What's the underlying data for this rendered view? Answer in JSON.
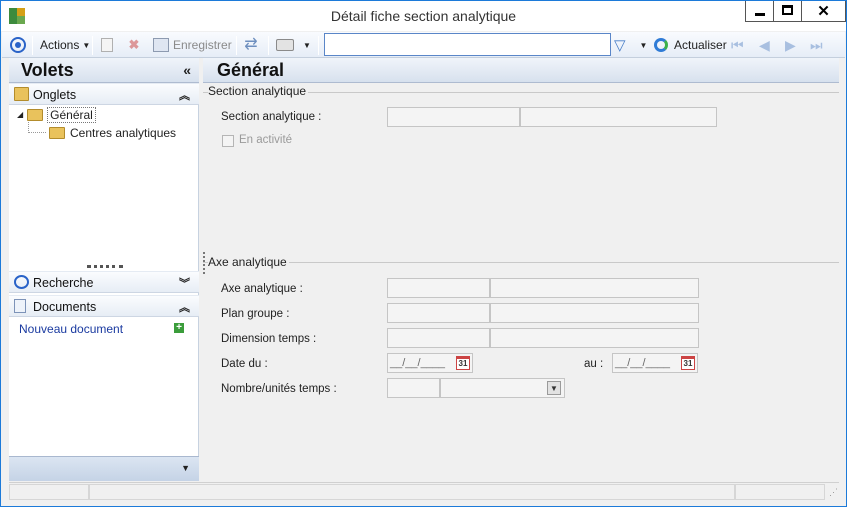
{
  "window": {
    "title": "Détail fiche section analytique",
    "close_glyph": "✕"
  },
  "toolbar": {
    "actions_label": "Actions",
    "save_label": "Enregistrer",
    "refresh_label": "Actualiser",
    "search_value": ""
  },
  "left_panel": {
    "title": "Volets",
    "collapse_glyph": "«",
    "onglets": {
      "label": "Onglets",
      "chevron": "⌃",
      "items": [
        {
          "label": "Général",
          "expander": "◢"
        },
        {
          "label": "Centres analytiques"
        }
      ]
    },
    "recherche": {
      "label": "Recherche",
      "chevron": "⌄"
    },
    "documents": {
      "label": "Documents",
      "chevron": "⌃",
      "new_document": "Nouveau document",
      "plus": "+"
    },
    "bottom_chevron": "▼"
  },
  "content": {
    "title": "Général",
    "section1": {
      "title": "Section analytique",
      "fields": [
        {
          "label": "Section analytique :"
        }
      ],
      "checkbox_label": "En activité"
    },
    "section2": {
      "title": "Axe analytique",
      "fields": [
        {
          "label": "Axe analytique :"
        },
        {
          "label": "Plan groupe :"
        },
        {
          "label": "Dimension temps :"
        },
        {
          "label": "Date du :"
        },
        {
          "label": "Nombre/unités temps :"
        }
      ],
      "date_to_label": "au :",
      "date_placeholder": "__/__/____",
      "calendar_text": "31",
      "dropdown_glyph": "▼"
    }
  },
  "statusbar": {
    "grip": "⋰"
  }
}
